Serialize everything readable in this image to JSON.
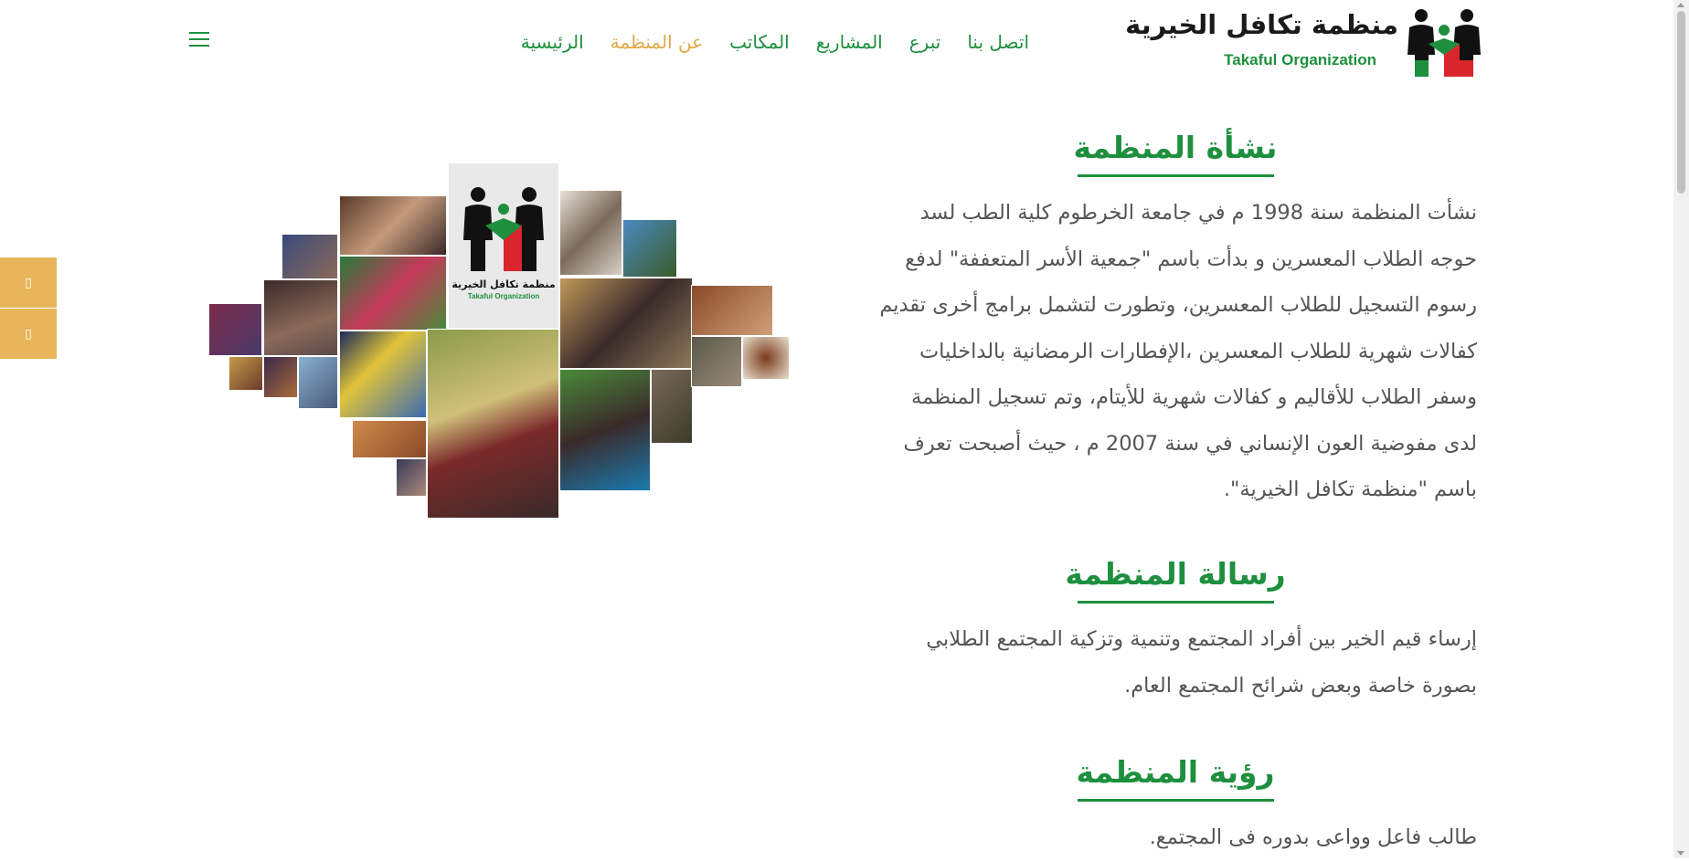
{
  "header": {
    "logo_arabic": "منظمة تكافل الخيرية",
    "logo_english": "Takaful Organization",
    "nav": [
      {
        "label": "الرئيسية",
        "active": false
      },
      {
        "label": "عن المنظمة",
        "active": true
      },
      {
        "label": "المكاتب",
        "active": false
      },
      {
        "label": "المشاريع",
        "active": false
      },
      {
        "label": "تبرع",
        "active": false
      },
      {
        "label": "اتصل بنا",
        "active": false
      }
    ],
    "menu_icon": "hamburger-menu-icon"
  },
  "side_tabs": [
    {
      "icon": "facebook-icon"
    },
    {
      "icon": "twitter-icon"
    }
  ],
  "collage": {
    "center_logo_arabic": "منظمة تكافل الخيرية",
    "center_logo_english": "Takaful Organization"
  },
  "sections": [
    {
      "title": "نشأة المنظمة",
      "body": "نشأت المنظمة سنة 1998 م في جامعة الخرطوم كلية الطب لسد حوجه الطلاب المعسرين و بدأت باسم \"جمعية الأسر المتعففة\" لدفع رسوم التسجيل للطلاب المعسرين، وتطورت لتشمل برامج أخرى تقديم كفالات شهرية للطلاب المعسرين ،الإفطارات الرمضانية بالداخليات وسفر الطلاب للأقاليم و كفالات شهرية للأيتام، وتم تسجيل المنظمة لدى مفوضية العون الإنساني في سنة 2007 م ، حيث أصبحت تعرف باسم \"منظمة تكافل الخيرية\"."
    },
    {
      "title": "رسالة المنظمة",
      "body": "إرساء قيم الخير بين أفراد المجتمع وتنمية وتزكية المجتمع الطلابي بصورة خاصة وبعض شرائح المجتمع العام."
    },
    {
      "title": "رؤية المنظمة",
      "body": "طالب فاعل وواعى بدوره فى المجتمع."
    }
  ],
  "colors": {
    "brand_green": "#1e8f3e",
    "accent_gold": "#e2a94a",
    "brand_red": "#d9262c",
    "side_tab": "#e8b55a"
  }
}
